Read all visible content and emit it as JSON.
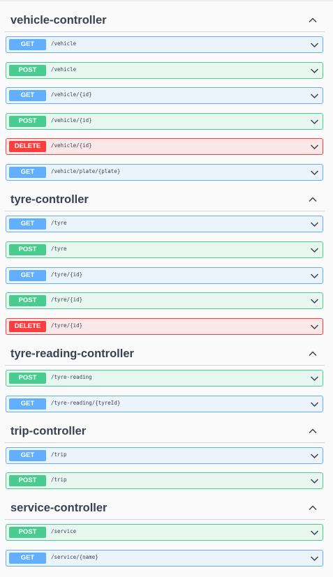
{
  "sections": [
    {
      "title": "vehicle-controller",
      "ops": [
        {
          "method": "GET",
          "path": "/vehicle"
        },
        {
          "method": "POST",
          "path": "/vehicle"
        },
        {
          "method": "GET",
          "path": "/vehicle/{id}"
        },
        {
          "method": "POST",
          "path": "/vehicle/{id}"
        },
        {
          "method": "DELETE",
          "path": "/vehicle/{id}"
        },
        {
          "method": "GET",
          "path": "/vehicle/plate/{plate}"
        }
      ]
    },
    {
      "title": "tyre-controller",
      "ops": [
        {
          "method": "GET",
          "path": "/tyre"
        },
        {
          "method": "POST",
          "path": "/tyre"
        },
        {
          "method": "GET",
          "path": "/tyre/{id}"
        },
        {
          "method": "POST",
          "path": "/tyre/{id}"
        },
        {
          "method": "DELETE",
          "path": "/tyre/{id}"
        }
      ]
    },
    {
      "title": "tyre-reading-controller",
      "ops": [
        {
          "method": "POST",
          "path": "/tyre-reading"
        },
        {
          "method": "GET",
          "path": "/tyre-reading/{tyreId}"
        }
      ]
    },
    {
      "title": "trip-controller",
      "ops": [
        {
          "method": "GET",
          "path": "/trip"
        },
        {
          "method": "POST",
          "path": "/trip"
        }
      ]
    },
    {
      "title": "service-controller",
      "ops": [
        {
          "method": "POST",
          "path": "/service"
        },
        {
          "method": "GET",
          "path": "/service/{name}"
        }
      ]
    }
  ],
  "colors": {
    "get": "#61affe",
    "post": "#49cc90",
    "delete": "#f93e3e"
  },
  "icons": {
    "section_toggle": "chevron-up-icon",
    "operation_toggle": "chevron-down-icon"
  }
}
